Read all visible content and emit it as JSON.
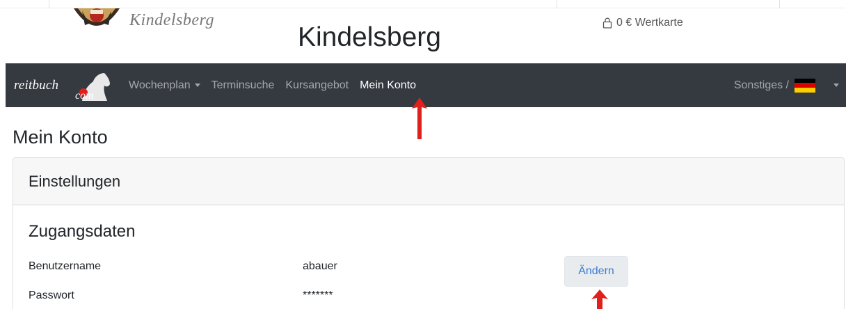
{
  "header": {
    "club_script": "Kindelsberg",
    "club_title": "Kindelsberg",
    "wallet": {
      "icon": "lock-icon",
      "label": "0 € Wertkarte"
    }
  },
  "navbar": {
    "brand": {
      "text": "reitbuch",
      "suffix": "com"
    },
    "items": [
      {
        "label": "Wochenplan",
        "dropdown": true,
        "active": false
      },
      {
        "label": "Terminsuche",
        "dropdown": false,
        "active": false
      },
      {
        "label": "Kursangebot",
        "dropdown": false,
        "active": false
      },
      {
        "label": "Mein Konto",
        "dropdown": false,
        "active": true
      }
    ],
    "right": {
      "label": "Sonstiges /",
      "flag": "german-flag-icon"
    }
  },
  "page": {
    "title": "Mein Konto",
    "card": {
      "header": "Einstellungen",
      "section_title": "Zugangsdaten",
      "rows": [
        {
          "label": "Benutzername",
          "value": "abauer"
        },
        {
          "label": "Passwort",
          "value": "*******"
        }
      ],
      "change_button": "Ändern"
    }
  },
  "colors": {
    "navbar_bg": "#343a40",
    "annotation_arrow": "#e0201b",
    "button_text": "#3b7bd1",
    "flag_black": "#000000",
    "flag_red": "#dd0000",
    "flag_gold": "#ffce00"
  }
}
